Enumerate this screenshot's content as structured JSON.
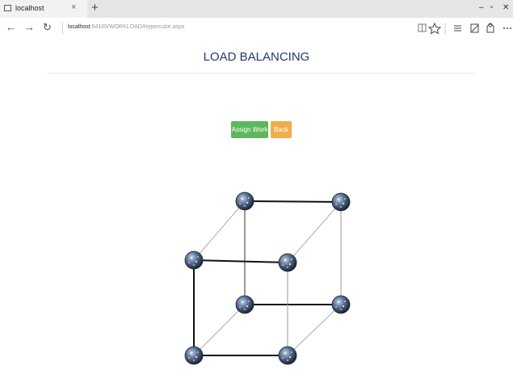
{
  "browser": {
    "tab_title": "localhost",
    "tab_close": "×",
    "new_tab": "+",
    "back": "←",
    "forward": "→",
    "refresh": "↻",
    "address_host": "localhost",
    "address_path": ":64165/WORKLOAD/Hypercube.aspx",
    "toolbar_icons": [
      "reading-view-icon",
      "favorite-star-icon",
      "hub-icon",
      "web-note-icon",
      "share-icon",
      "more-icon"
    ],
    "window_controls": [
      "–",
      "▫",
      "✕"
    ]
  },
  "page": {
    "title": "LOAD BALANCING",
    "buttons": {
      "assign_work": "Assign Work",
      "back": "Back"
    }
  },
  "colors": {
    "assign_work": "#5cb85c",
    "back": "#f0ad4e",
    "title": "#1f3d6b",
    "node": "#445a7a"
  },
  "hypercube": {
    "node_count": 8,
    "node_icon": "globe-node-icon"
  }
}
